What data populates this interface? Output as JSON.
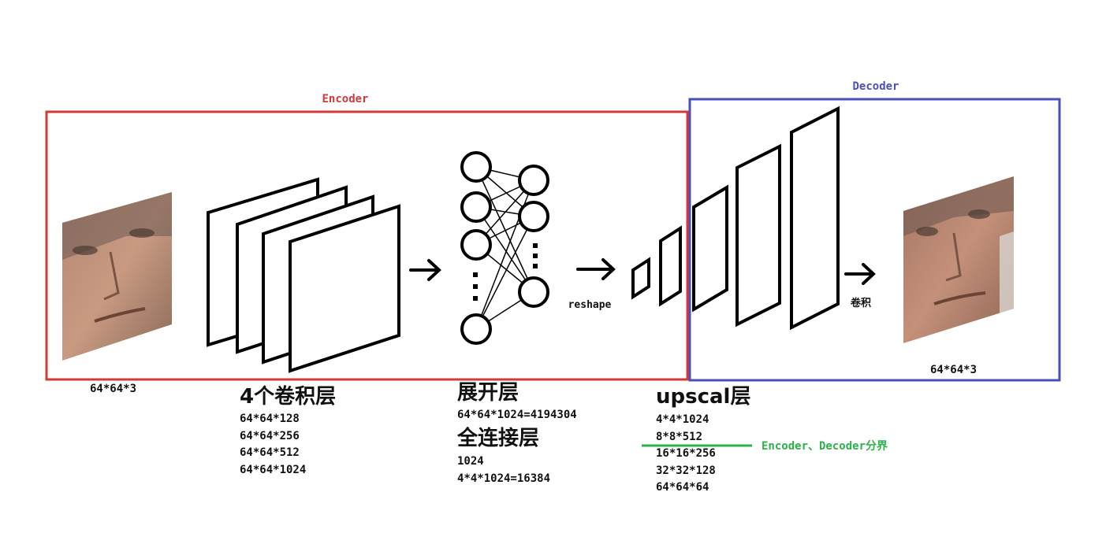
{
  "encoder": {
    "label": "Encoder",
    "color": "#d23a3a"
  },
  "decoder": {
    "label": "Decoder",
    "color": "#4b4fb8"
  },
  "boundary": {
    "label": "Encoder、Decoder分界",
    "color": "#2bb24b"
  },
  "input_face": {
    "size": "64*64*3"
  },
  "output_face": {
    "size": "64*64*3"
  },
  "arrows": {
    "reshape": "reshape",
    "conv": "卷积"
  },
  "conv_section": {
    "title": "4个卷积层",
    "dims": [
      "64*64*128",
      "64*64*256",
      "64*64*512",
      "64*64*1024"
    ]
  },
  "flatten_section": {
    "title": "展开层",
    "dims": [
      "64*64*1024=4194304"
    ]
  },
  "fc_section": {
    "title": "全连接层",
    "dims": [
      "1024",
      "4*4*1024=16384"
    ]
  },
  "upscale_section": {
    "title": "upscal层",
    "dims": [
      "4*4*1024",
      "8*8*512",
      "16*16*256",
      "32*32*128",
      "64*64*64"
    ]
  }
}
